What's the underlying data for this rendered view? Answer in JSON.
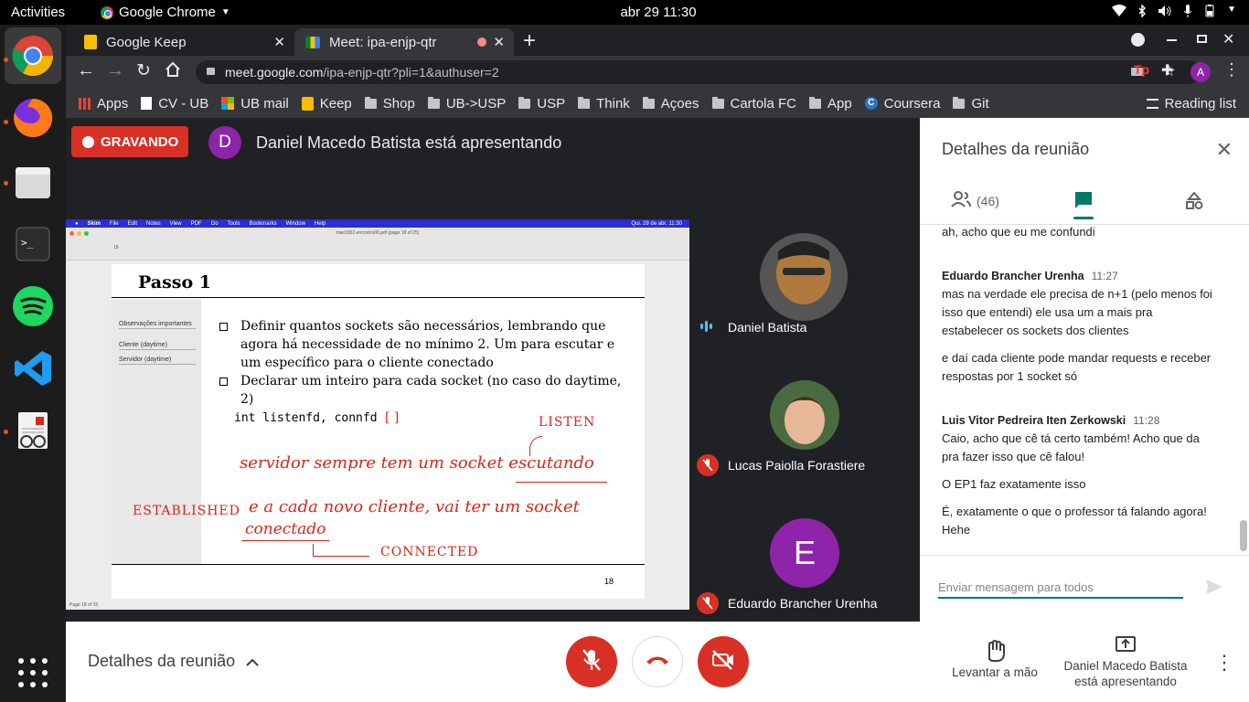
{
  "system": {
    "activities": "Activities",
    "app_name": "Google Chrome",
    "clock": "abr 29  11:30"
  },
  "browser": {
    "tabs": [
      {
        "label": "Google Keep"
      },
      {
        "label": "Meet: ipa-enjp-qtr"
      }
    ],
    "url_host": "meet.google.com",
    "url_path": "/ipa-enjp-qtr?pli=1&authuser=2",
    "profile_initial": "A",
    "bookmarks": [
      "Apps",
      "CV - UB",
      "UB mail",
      "Keep",
      "Shop",
      "UB->USP",
      "USP",
      "Think",
      "Açoes",
      "Cartola FC",
      "App",
      "Coursera",
      "Git"
    ],
    "reading_list": "Reading list"
  },
  "meet": {
    "recording_label": "GRAVANDO",
    "presenter_initial": "D",
    "presenter_text": "Daniel Macedo Batista está apresentando",
    "participants": [
      {
        "name": "Daniel Batista",
        "muted": false
      },
      {
        "name": "Lucas Paiolla Forastiere",
        "muted": true
      },
      {
        "name": "Eduardo Brancher Urenha",
        "muted": true,
        "initial": "E"
      }
    ],
    "shared_screen": {
      "menubar": [
        "Skim",
        "File",
        "Edit",
        "Notes",
        "View",
        "PDF",
        "Go",
        "Tools",
        "Bookmarks",
        "Window",
        "Help"
      ],
      "menubar_clock": "Qui. 29 de abr.  11:30",
      "doc_title": "mac0352-encontro06.pdf (page 18 of 25)",
      "page_field": "18",
      "status": "Page 18 of 25",
      "slide": {
        "title": "Passo 1",
        "sidebar": [
          "Observações importantes",
          "Cliente (daytime)",
          "Servidor (daytime)"
        ],
        "bullet1": "Definir quantos sockets são necessários, lembrando que agora há necessidade de no mínimo 2. Um para escutar e um específico para o cliente conectado",
        "bullet2": "Declarar um inteiro para cada socket (no caso do daytime, 2)",
        "code": "int listenfd, connfd",
        "page_number": "18"
      },
      "handwriting": {
        "listen": "LISTEN",
        "line1": "servidor sempre tem um socket escutando",
        "established": "ESTABLISHED",
        "line2": "e a cada novo cliente, vai ter um socket",
        "line3": "conectado",
        "connected": "CONNECTED"
      }
    },
    "panel": {
      "title": "Detalhes da reunião",
      "people_count": "(46)",
      "messages": [
        {
          "author": "",
          "time": "",
          "texts": [
            "ah, acho que eu me confundi"
          ]
        },
        {
          "author": "Eduardo Brancher Urenha",
          "time": "11:27",
          "texts": [
            "mas na verdade ele precisa de n+1 (pelo menos foi isso que entendi) ele usa um a mais pra estabelecer os sockets dos clientes",
            "e daí cada cliente pode mandar requests e receber respostas por 1 socket só"
          ]
        },
        {
          "author": "Luis Vitor Pedreira Iten Zerkowski",
          "time": "11:28",
          "texts": [
            "Caio, acho que cê tá certo também! Acho que da pra fazer isso que cê falou!",
            "O EP1 faz exatamente isso",
            "É, exatamente o que o professor tá falando agora! Hehe"
          ]
        }
      ],
      "compose_placeholder": "Enviar mensagem para todos"
    },
    "bottom": {
      "details_label": "Detalhes da reunião",
      "raise_hand": "Levantar a mão",
      "presenting_line1": "Daniel Macedo Batista",
      "presenting_line2": "está apresentando"
    }
  },
  "colors": {
    "red": "#d93025",
    "purple": "#8e24aa",
    "teal": "#00796b",
    "chrome_dark": "#35363a"
  }
}
